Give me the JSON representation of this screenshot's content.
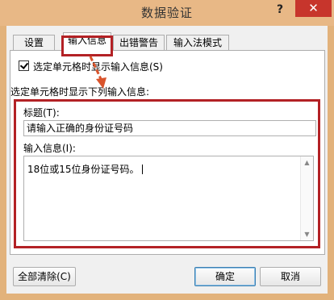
{
  "window": {
    "title": "数据验证",
    "help_glyph": "?",
    "close_glyph": "✕"
  },
  "tabs": [
    {
      "label": "设置"
    },
    {
      "label": "输入信息"
    },
    {
      "label": "出错警告"
    },
    {
      "label": "输入法模式"
    }
  ],
  "panel": {
    "show_checkbox_label": "选定单元格时显示输入信息(S)",
    "section_label": "选定单元格时显示下列输入信息:",
    "title_label": "标题(T):",
    "title_value": "请输入正确的身份证号码",
    "message_label": "输入信息(I):",
    "message_value": "18位或15位身份证号码。"
  },
  "buttons": {
    "clear_all": "全部清除(C)",
    "ok": "确定",
    "cancel": "取消"
  },
  "annotation": {
    "highlight_color": "#b32125",
    "arrow_color": "#d9542c"
  }
}
